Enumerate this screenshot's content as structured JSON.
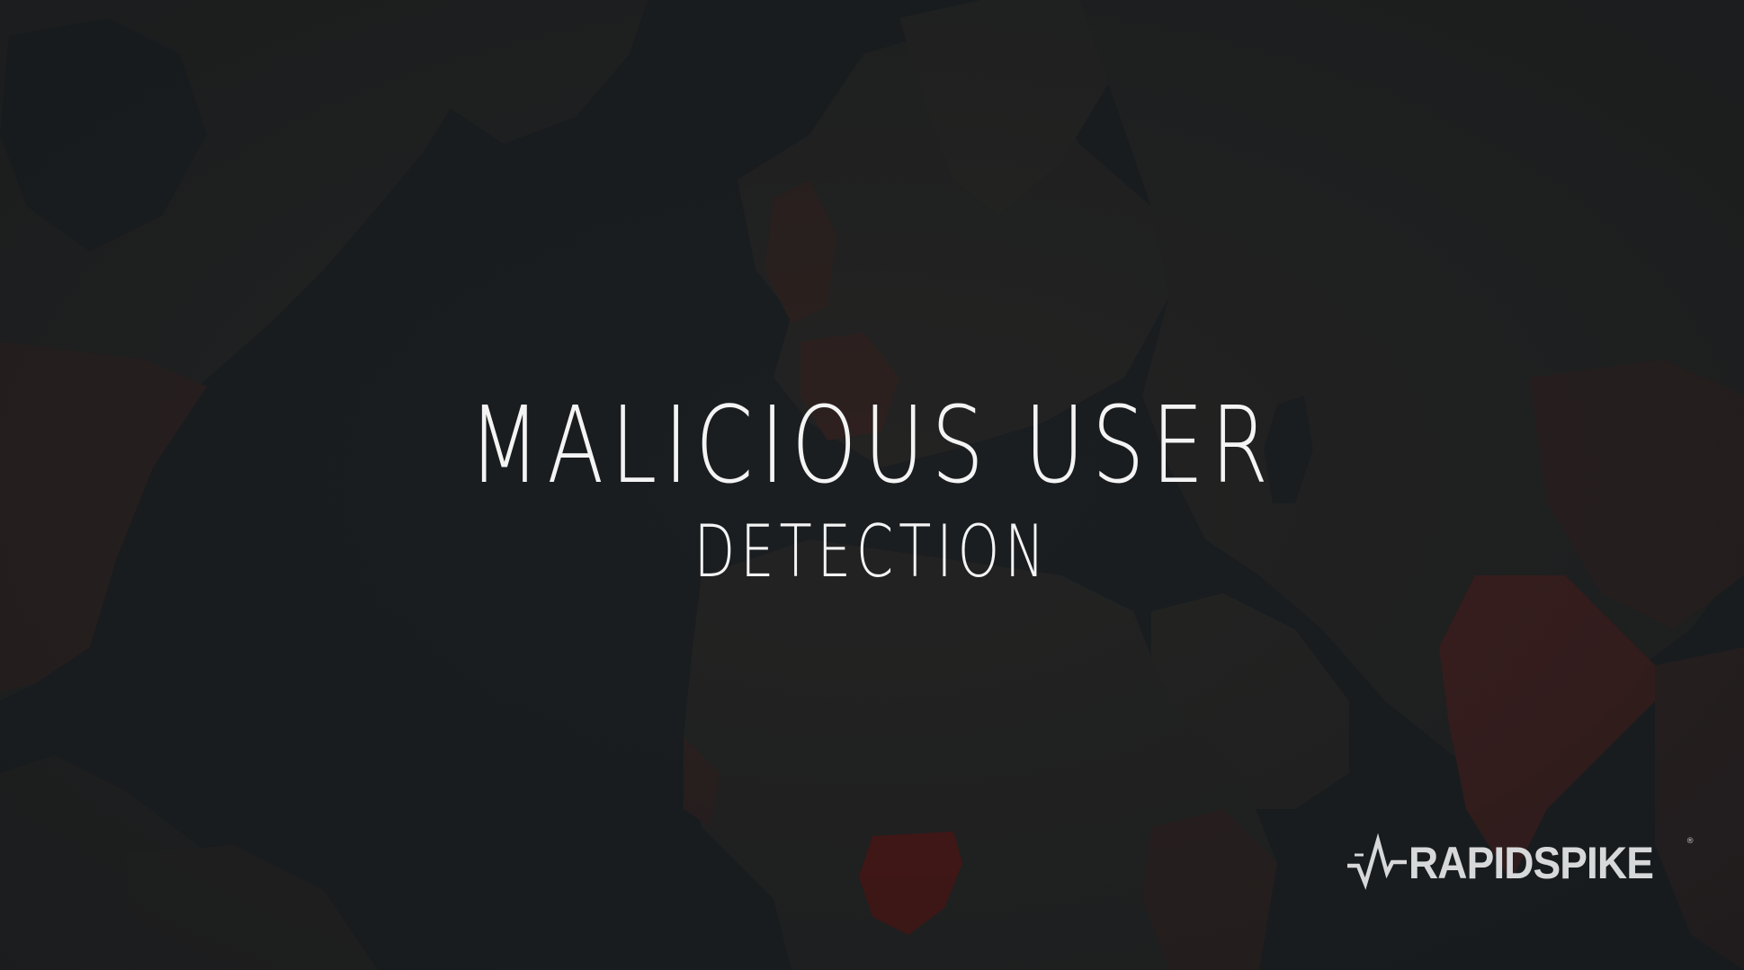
{
  "headline": {
    "title": "MALICIOUS USER",
    "subtitle": "DETECTION"
  },
  "logo": {
    "name": "RAPIDSPIKE",
    "mark_icon": "pulse-spike-logo-icon",
    "registered_mark": "®"
  },
  "colors": {
    "background": "#1c2022",
    "land": "#2a2a29",
    "land_highlight": "#5a2220",
    "land_strong_highlight": "#6e1612",
    "text": "#f4f4f4"
  }
}
